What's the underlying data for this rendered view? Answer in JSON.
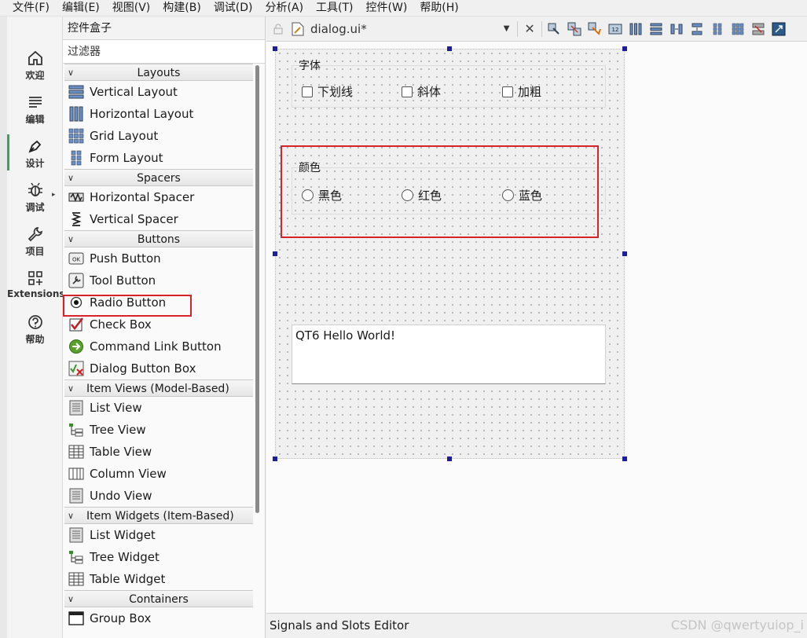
{
  "menubar": [
    "文件(F)",
    "编辑(E)",
    "视图(V)",
    "构建(B)",
    "调试(D)",
    "分析(A)",
    "工具(T)",
    "控件(W)",
    "帮助(H)"
  ],
  "modes": [
    {
      "label": "欢迎",
      "icon": "home-icon"
    },
    {
      "label": "编辑",
      "icon": "edit-lines-icon"
    },
    {
      "label": "设计",
      "icon": "pen-icon"
    },
    {
      "label": "调试",
      "icon": "bug-icon"
    },
    {
      "label": "项目",
      "icon": "wrench-icon"
    },
    {
      "label": "Extensions",
      "icon": "extensions-icon"
    },
    {
      "label": "帮助",
      "icon": "help-icon"
    }
  ],
  "widgetbox": {
    "title": "控件盒子",
    "filter_placeholder": "过滤器",
    "categories": {
      "layouts": "Layouts",
      "spacers": "Spacers",
      "buttons": "Buttons",
      "item_views": "Item Views (Model-Based)",
      "item_widgets": "Item Widgets (Item-Based)",
      "containers": "Containers"
    },
    "items": {
      "vertical_layout": "Vertical Layout",
      "horizontal_layout": "Horizontal Layout",
      "grid_layout": "Grid Layout",
      "form_layout": "Form Layout",
      "horizontal_spacer": "Horizontal Spacer",
      "vertical_spacer": "Vertical Spacer",
      "push_button": "Push Button",
      "tool_button": "Tool Button",
      "radio_button": "Radio Button",
      "check_box": "Check Box",
      "command_link_button": "Command Link Button",
      "dialog_button_box": "Dialog Button Box",
      "list_view": "List View",
      "tree_view": "Tree View",
      "table_view": "Table View",
      "column_view": "Column View",
      "undo_view": "Undo View",
      "list_widget": "List Widget",
      "tree_widget": "Tree Widget",
      "table_widget": "Table Widget",
      "group_box": "Group Box"
    }
  },
  "editor": {
    "tab_name": "dialog.ui*"
  },
  "form": {
    "font_group": {
      "title": "字体",
      "options": [
        "下划线",
        "斜体",
        "加粗"
      ]
    },
    "color_group": {
      "title": "颜色",
      "options": [
        "黑色",
        "红色",
        "蓝色"
      ]
    },
    "text_edit": "QT6 Hello World!"
  },
  "signals_editor": "Signals and Slots Editor",
  "watermark": "CSDN @qwertyuiop_i",
  "colors": {
    "highlight": "#d9232a",
    "handle": "#1e1e9a",
    "active_mode": "#3aa55a"
  }
}
